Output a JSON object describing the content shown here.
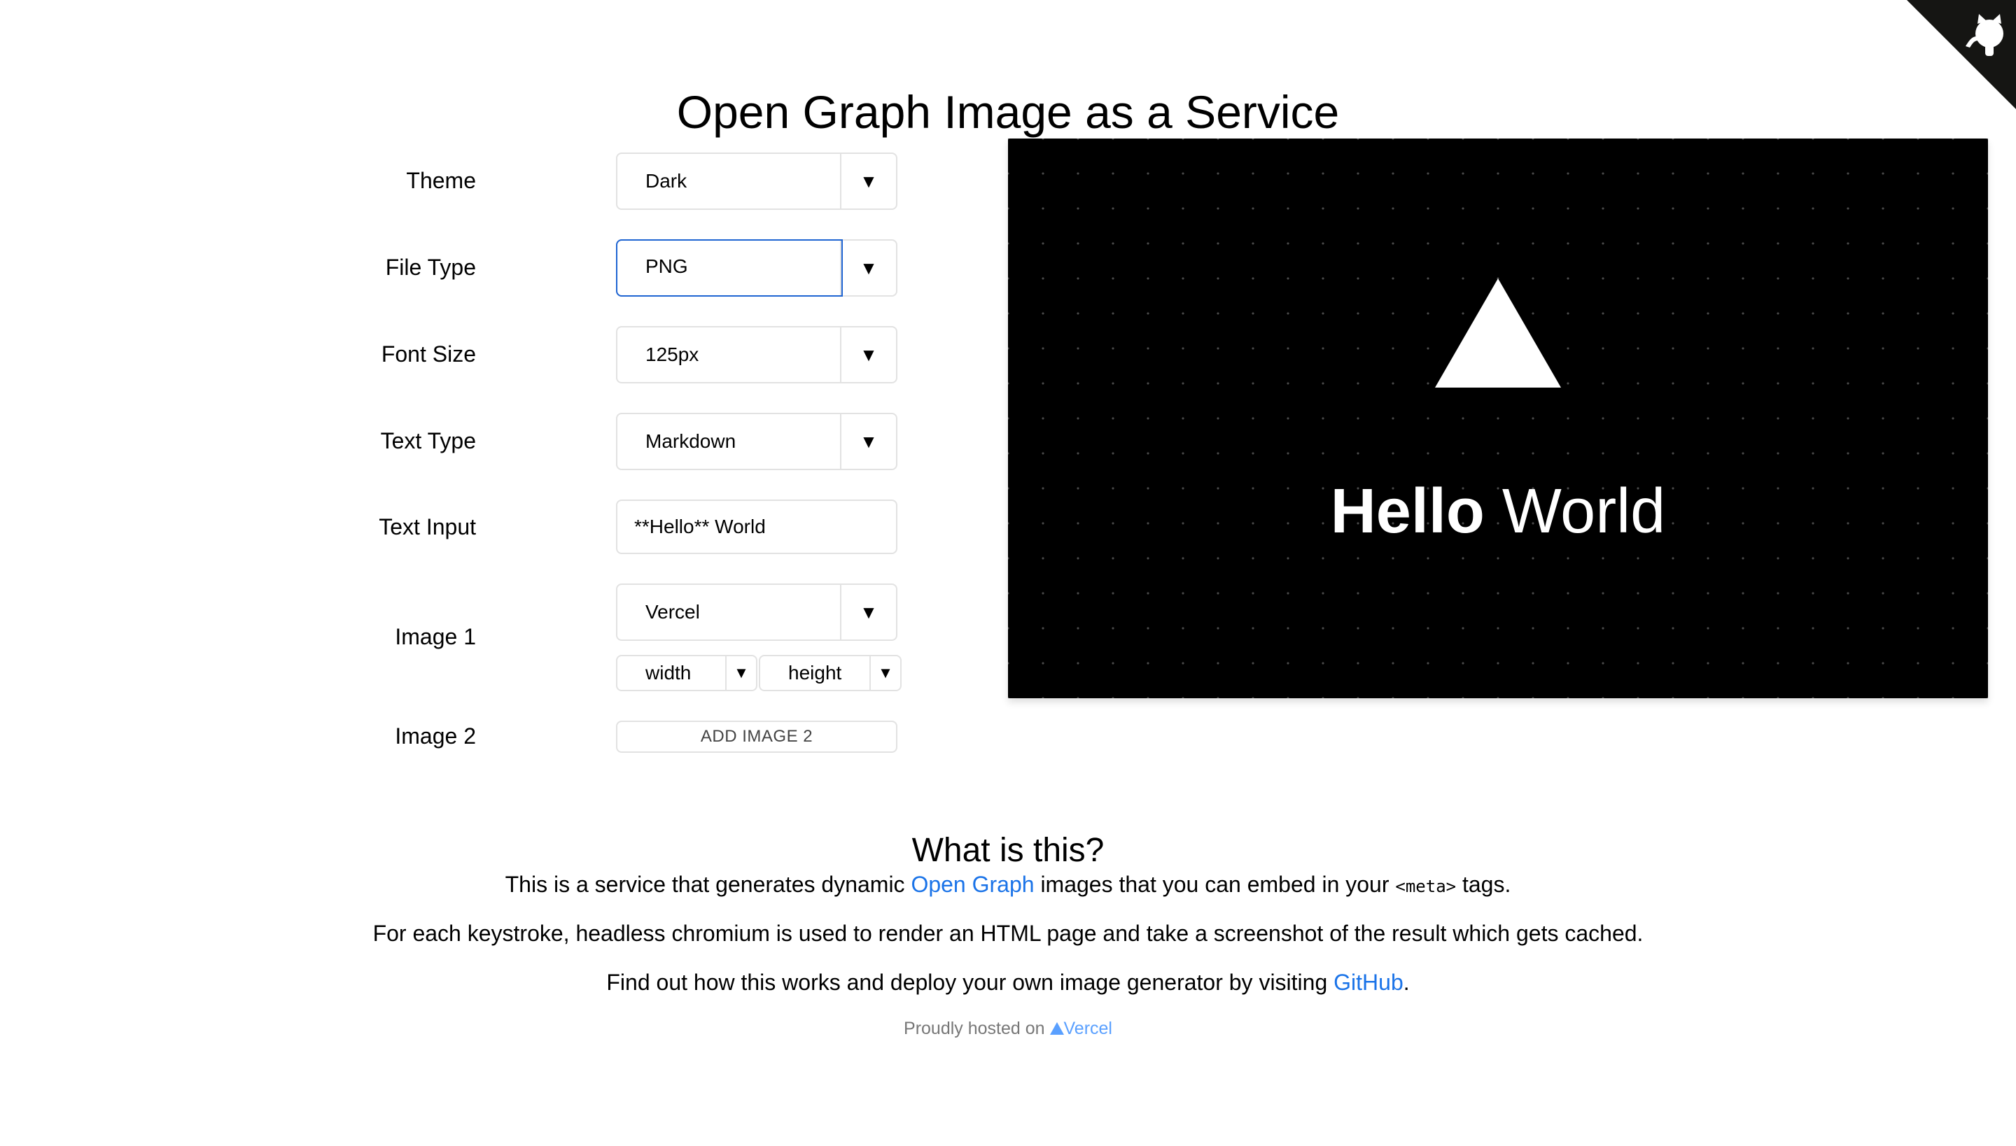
{
  "page": {
    "title": "Open Graph Image as a Service"
  },
  "form": {
    "theme": {
      "label": "Theme",
      "value": "Dark"
    },
    "file_type": {
      "label": "File Type",
      "value": "PNG"
    },
    "font_size": {
      "label": "Font Size",
      "value": "125px"
    },
    "text_type": {
      "label": "Text Type",
      "value": "Markdown"
    },
    "text_input": {
      "label": "Text Input",
      "value": "**Hello** World"
    },
    "image1": {
      "label": "Image 1",
      "value": "Vercel",
      "width_placeholder": "width",
      "height_placeholder": "height"
    },
    "image2": {
      "label": "Image 2",
      "button_label": "ADD IMAGE 2"
    },
    "dropdown_arrow": "▼"
  },
  "preview": {
    "bold_text": "Hello",
    "normal_text": " World",
    "background": "#000000",
    "text_color": "#ffffff"
  },
  "about": {
    "title": "What is this?",
    "p1_before": "This is a service that generates dynamic ",
    "p1_link": "Open Graph",
    "p1_middle": " images that you can embed in your ",
    "p1_code": "<meta>",
    "p1_after": " tags.",
    "p2": "For each keystroke, headless chromium is used to render an HTML page and take a screenshot of the result which gets cached.",
    "p3_before": "Find out how this works and deploy your own image generator by visiting ",
    "p3_link": "GitHub",
    "p3_after": "."
  },
  "footer": {
    "text": "Proudly hosted on ",
    "brand": "Vercel"
  },
  "colors": {
    "link": "#1a73e8",
    "focus_border": "#1e64d2",
    "border": "#e2e2e2"
  },
  "icons": {
    "corner": "github-octocat-icon",
    "vercel": "vercel-triangle-icon",
    "dropdown": "chevron-down-icon"
  }
}
